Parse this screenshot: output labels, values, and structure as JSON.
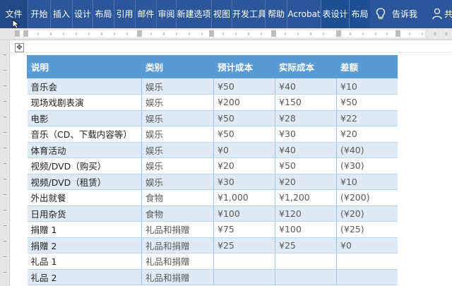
{
  "ribbon": {
    "tabs": [
      "文件",
      "开始",
      "插入",
      "设计",
      "布局",
      "引用",
      "邮件",
      "审阅",
      "新建选项",
      "视图",
      "开发工具",
      "帮助",
      "Acrobat",
      "表设计",
      "布局"
    ],
    "tell_me": "告诉我",
    "overflow": "共"
  },
  "colors": {
    "ribbon": "#2b579a",
    "table_header": "#5b9bd5",
    "row_alt": "#deeaf6"
  },
  "table": {
    "headers": [
      "说明",
      "类别",
      "预计成本",
      "实际成本",
      "差额"
    ],
    "rows": [
      [
        "音乐会",
        "娱乐",
        "¥50",
        "¥40",
        "¥10"
      ],
      [
        "现场戏剧表演",
        "娱乐",
        "¥200",
        "¥150",
        "¥50"
      ],
      [
        "电影",
        "娱乐",
        "¥50",
        "¥28",
        "¥22"
      ],
      [
        "音乐（CD、下载内容等）",
        "娱乐",
        "¥50",
        "¥30",
        "¥20"
      ],
      [
        "体育活动",
        "娱乐",
        "¥0",
        "¥40",
        "(¥40)"
      ],
      [
        "视频/DVD（购买）",
        "娱乐",
        "¥20",
        "¥50",
        "(¥30)"
      ],
      [
        "视频/DVD（租赁）",
        "娱乐",
        "¥30",
        "¥20",
        "¥10"
      ],
      [
        "外出就餐",
        "食物",
        "¥1,000",
        "¥1,200",
        "(¥200)"
      ],
      [
        "日用杂货",
        "食物",
        "¥100",
        "¥120",
        "(¥20)"
      ],
      [
        "捐赠  1",
        "礼品和捐赠",
        "¥75",
        "¥100",
        "(¥25)"
      ],
      [
        "捐赠  2",
        "礼品和捐赠",
        "¥25",
        "¥25",
        "¥0"
      ],
      [
        "礼品  1",
        "礼品和捐赠",
        "",
        "",
        ""
      ],
      [
        "礼品  2",
        "礼品和捐赠",
        "",
        "",
        ""
      ]
    ]
  }
}
